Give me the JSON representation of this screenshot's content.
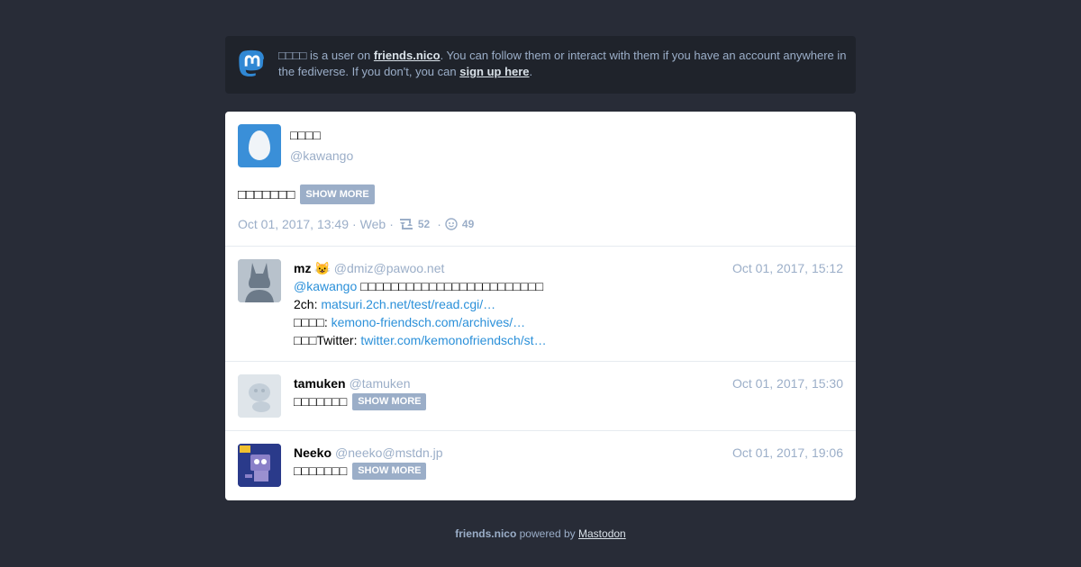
{
  "banner": {
    "display_name": "□□□□",
    "text_pre": "is a user on",
    "instance": "friends.nico",
    "text_mid": ". You can follow them or interact with them if you have an account anywhere in the fediverse. If you don't, you can",
    "signup_label": "sign up here",
    "text_end": "."
  },
  "detailed": {
    "display_name": "□□□□",
    "acct": "@kawango",
    "spoiler_text": "□□□□□□□",
    "show_more": "SHOW MORE",
    "date": "Oct 01, 2017, 13:49",
    "application": "Web",
    "reblogs": "52",
    "favourites": "49"
  },
  "replies": [
    {
      "name": "mz 😺",
      "handle": "@dmiz@pawoo.net",
      "time": "Oct 01, 2017, 15:12",
      "mention": "@kawango",
      "line1_rest": "□□□□□□□□□□□□□□□□□□□□□□□□",
      "line2_prefix": "2ch:",
      "line2_link": "matsuri.2ch.net/test/read.cgi/…",
      "line3_prefix": "□□□□:",
      "line3_link": "kemono-friendsch.com/archives/…",
      "line4_prefix": "□□□Twitter:",
      "line4_link": "twitter.com/kemonofriendsch/st…"
    },
    {
      "name": "tamuken",
      "handle": "@tamuken",
      "time": "Oct 01, 2017, 15:30",
      "spoiler_text": "□□□□□□□",
      "show_more": "SHOW MORE"
    },
    {
      "name": "Neeko",
      "handle": "@neeko@mstdn.jp",
      "time": "Oct 01, 2017, 19:06",
      "spoiler_text": "□□□□□□□",
      "show_more": "SHOW MORE"
    }
  ],
  "footer": {
    "instance": "friends.nico",
    "powered_by": "powered by",
    "mastodon": "Mastodon"
  },
  "icons": {
    "logo": "mastodon-logo-icon",
    "reblog": "retweet-icon",
    "favourite": "star-icon"
  },
  "colors": {
    "background": "#282c37",
    "banner_bg": "#1f232b",
    "accent": "#2b90d9",
    "muted": "#9baec8"
  }
}
